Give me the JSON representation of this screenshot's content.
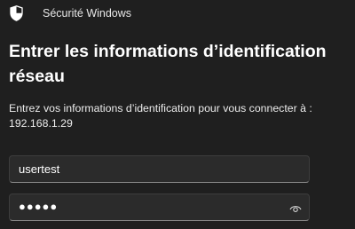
{
  "window": {
    "title": "Sécurité Windows",
    "icon": "shield-icon"
  },
  "dialog": {
    "heading": "Entrer les informations d’identification réseau",
    "description_line1": "Entrez vos informations d’identification pour vous connecter à :",
    "description_line2": "192.168.1.29"
  },
  "form": {
    "username_value": "usertest",
    "password_mask": "●●●●●",
    "reveal_icon": "eye-icon"
  },
  "colors": {
    "background": "#1f1f1f",
    "field_background": "#2b2b2b",
    "field_border": "#3d3d3d"
  }
}
